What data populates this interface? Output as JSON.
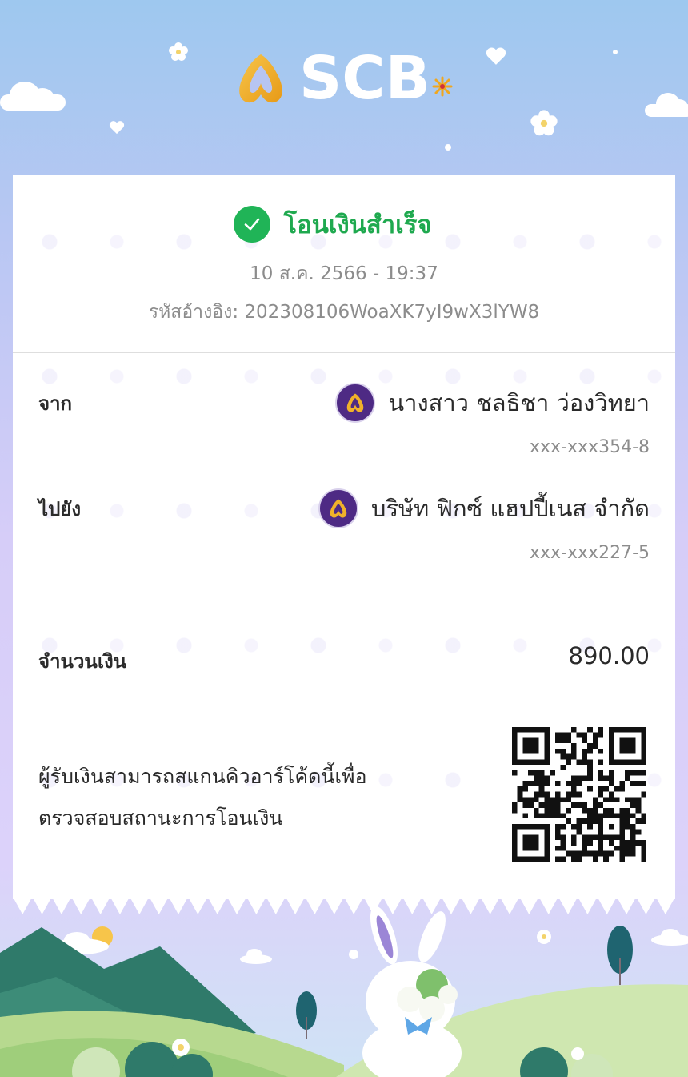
{
  "brand": {
    "name": "SCB"
  },
  "receipt": {
    "status": "โอนเงินสำเร็จ",
    "datetime": "10 ส.ค. 2566 - 19:37",
    "reference": "รหัสอ้างอิง: 202308106WoaXK7yI9wX3lYW8"
  },
  "from": {
    "label": "จาก",
    "name": "นางสาว ชลธิชา ว่องวิทยา",
    "account": "xxx-xxx354-8"
  },
  "to": {
    "label": "ไปยัง",
    "name": "บริษัท ฟิกซ์ แฮปปี้เนส จำกัด",
    "account": "xxx-xxx227-5"
  },
  "amount": {
    "label": "จำนวนเงิน",
    "value": "890.00"
  },
  "qr": {
    "line1": "ผู้รับเงินสามารถสแกนคิวอาร์โค้ดนี้เพื่อ",
    "line2": "ตรวจสอบสถานะการโอนเงิน"
  },
  "colors": {
    "brand_gold": "#f0b12a",
    "brand_purple": "#4e2a84",
    "success_green": "#20b457",
    "card_bg": "#ffffff"
  },
  "icons": [
    "scb-logo-icon",
    "check-circle-icon",
    "bank-icon",
    "qr-code-icon"
  ]
}
